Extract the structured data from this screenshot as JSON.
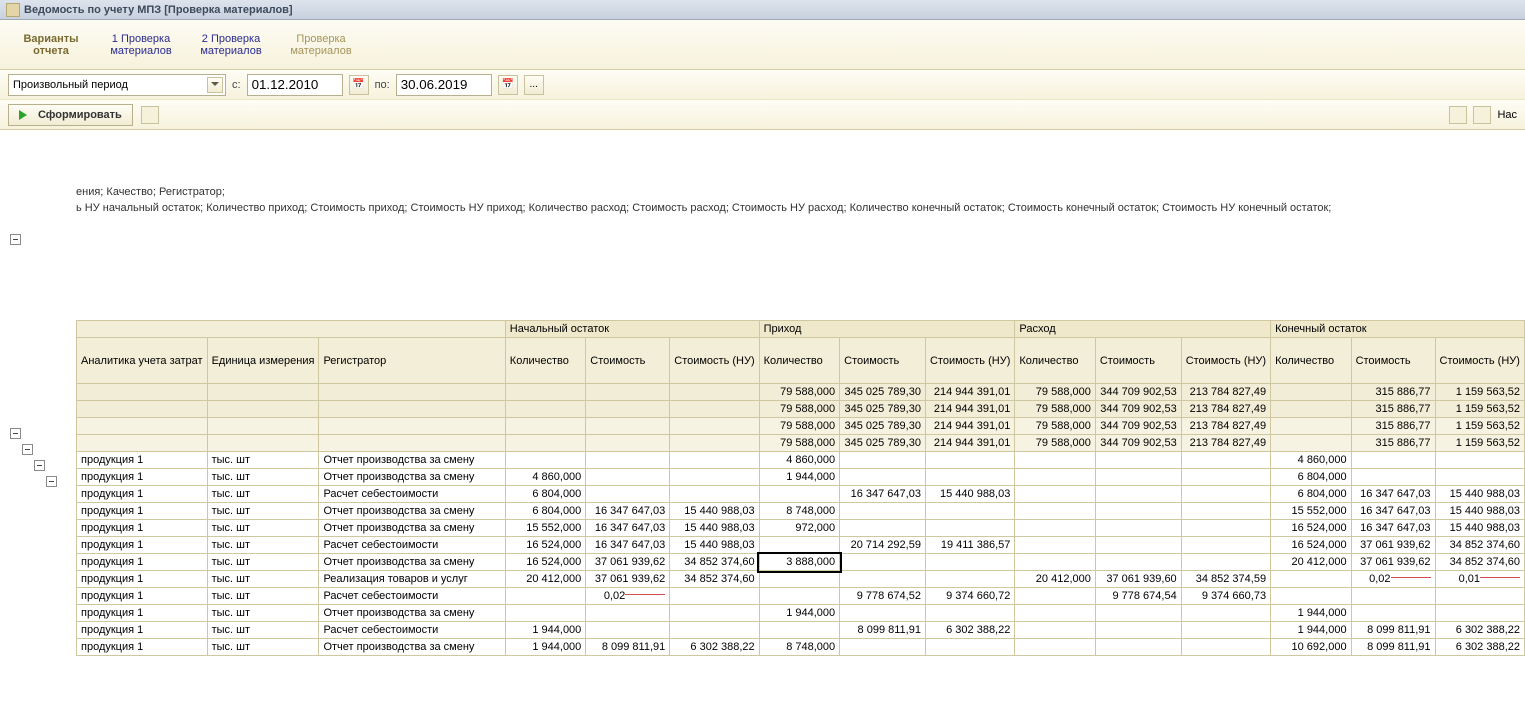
{
  "window_title": "Ведомость по учету МПЗ [Проверка материалов]",
  "tabs": {
    "variants": "Варианты\nотчета",
    "t1": "1 Проверка\nматериалов",
    "t2": "2 Проверка\nматериалов",
    "t3": "Проверка\nматериалов"
  },
  "period": {
    "combo_text": "Произвольный период",
    "from_label": "с:",
    "from": "01.12.2010",
    "to_label": "по:",
    "to": "30.06.2019"
  },
  "generate_label": "Сформировать",
  "right_btn_label": "Нас",
  "subheader_line1": "ения; Качество; Регистратор;",
  "subheader_line2": "ь НУ начальный остаток; Количество приход; Стоимость приход; Стоимость НУ приход; Количество расход; Стоимость расход; Стоимость НУ расход; Количество конечный остаток; Стоимость конечный остаток; Стоимость НУ конечный остаток;",
  "headers": {
    "col_analytics": "Аналитика учета затрат",
    "col_unit": "Единица измерения",
    "col_reg": "Регистратор",
    "group_begin": "Начальный остаток",
    "group_in": "Приход",
    "group_out": "Расход",
    "group_end": "Конечный остаток",
    "qty": "Количество",
    "cost": "Стоимость",
    "cost_nu": "Стоимость (НУ)"
  },
  "labels": {
    "product": "продукция 1",
    "unit": "тыс. шт",
    "reg_shift": "Отчет производства за смену",
    "reg_cost": "Расчет себестоимости",
    "reg_sale": "Реализация товаров и услуг"
  },
  "totals": [
    {
      "in_qty": "79 588,000",
      "in_cost": "345 025 789,30",
      "in_nu": "214 944 391,01",
      "out_qty": "79 588,000",
      "out_cost": "344 709 902,53",
      "out_nu": "213 784 827,49",
      "end_cost": "315 886,77",
      "end_nu": "1 159 563,52"
    },
    {
      "in_qty": "79 588,000",
      "in_cost": "345 025 789,30",
      "in_nu": "214 944 391,01",
      "out_qty": "79 588,000",
      "out_cost": "344 709 902,53",
      "out_nu": "213 784 827,49",
      "end_cost": "315 886,77",
      "end_nu": "1 159 563,52"
    },
    {
      "in_qty": "79 588,000",
      "in_cost": "345 025 789,30",
      "in_nu": "214 944 391,01",
      "out_qty": "79 588,000",
      "out_cost": "344 709 902,53",
      "out_nu": "213 784 827,49",
      "end_cost": "315 886,77",
      "end_nu": "1 159 563,52"
    },
    {
      "in_qty": "79 588,000",
      "in_cost": "345 025 789,30",
      "in_nu": "214 944 391,01",
      "out_qty": "79 588,000",
      "out_cost": "344 709 902,53",
      "out_nu": "213 784 827,49",
      "end_cost": "315 886,77",
      "end_nu": "1 159 563,52"
    }
  ],
  "rows": [
    {
      "reg": "reg_shift",
      "in_qty": "4 860,000",
      "end_qty": "4 860,000"
    },
    {
      "reg": "reg_shift",
      "b_qty": "4 860,000",
      "in_qty": "1 944,000",
      "end_qty": "6 804,000"
    },
    {
      "reg": "reg_cost",
      "b_qty": "6 804,000",
      "in_cost": "16 347 647,03",
      "in_nu": "15 440 988,03",
      "end_qty": "6 804,000",
      "end_cost": "16 347 647,03",
      "end_nu": "15 440 988,03"
    },
    {
      "reg": "reg_shift",
      "b_qty": "6 804,000",
      "b_cost": "16 347 647,03",
      "b_nu": "15 440 988,03",
      "in_qty": "8 748,000",
      "end_qty": "15 552,000",
      "end_cost": "16 347 647,03",
      "end_nu": "15 440 988,03"
    },
    {
      "reg": "reg_shift",
      "b_qty": "15 552,000",
      "b_cost": "16 347 647,03",
      "b_nu": "15 440 988,03",
      "in_qty": "972,000",
      "end_qty": "16 524,000",
      "end_cost": "16 347 647,03",
      "end_nu": "15 440 988,03"
    },
    {
      "reg": "reg_cost",
      "b_qty": "16 524,000",
      "b_cost": "16 347 647,03",
      "b_nu": "15 440 988,03",
      "in_cost": "20 714 292,59",
      "in_nu": "19 411 386,57",
      "end_qty": "16 524,000",
      "end_cost": "37 061 939,62",
      "end_nu": "34 852 374,60"
    },
    {
      "reg": "reg_shift",
      "b_qty": "16 524,000",
      "b_cost": "37 061 939,62",
      "b_nu": "34 852 374,60",
      "in_qty": "3 888,000",
      "selected": true,
      "end_qty": "20 412,000",
      "end_cost": "37 061 939,62",
      "end_nu": "34 852 374,60"
    },
    {
      "reg": "reg_sale",
      "b_qty": "20 412,000",
      "b_cost": "37 061 939,62",
      "b_nu": "34 852 374,60",
      "out_qty": "20 412,000",
      "out_cost": "37 061 939,60",
      "out_nu": "34 852 374,59",
      "end_cost": "0,02",
      "end_nu": "0,01",
      "spark": true
    },
    {
      "reg": "reg_cost",
      "b_cost": "0,02",
      "b_nu_blank": true,
      "in_cost": "9 778 674,52",
      "in_nu": "9 374 660,72",
      "out_cost": "9 778 674,54",
      "out_nu": "9 374 660,73",
      "spark_b": true
    },
    {
      "reg": "reg_shift",
      "in_qty": "1 944,000",
      "end_qty": "1 944,000"
    },
    {
      "reg": "reg_cost",
      "b_qty": "1 944,000",
      "in_cost": "8 099 811,91",
      "in_nu": "6 302 388,22",
      "end_qty": "1 944,000",
      "end_cost": "8 099 811,91",
      "end_nu": "6 302 388,22"
    },
    {
      "reg": "reg_shift",
      "b_qty": "1 944,000",
      "b_cost": "8 099 811,91",
      "b_nu": "6 302 388,22",
      "in_qty": "8 748,000",
      "end_qty": "10 692,000",
      "end_cost": "8 099 811,91",
      "end_nu": "6 302 388,22"
    }
  ]
}
